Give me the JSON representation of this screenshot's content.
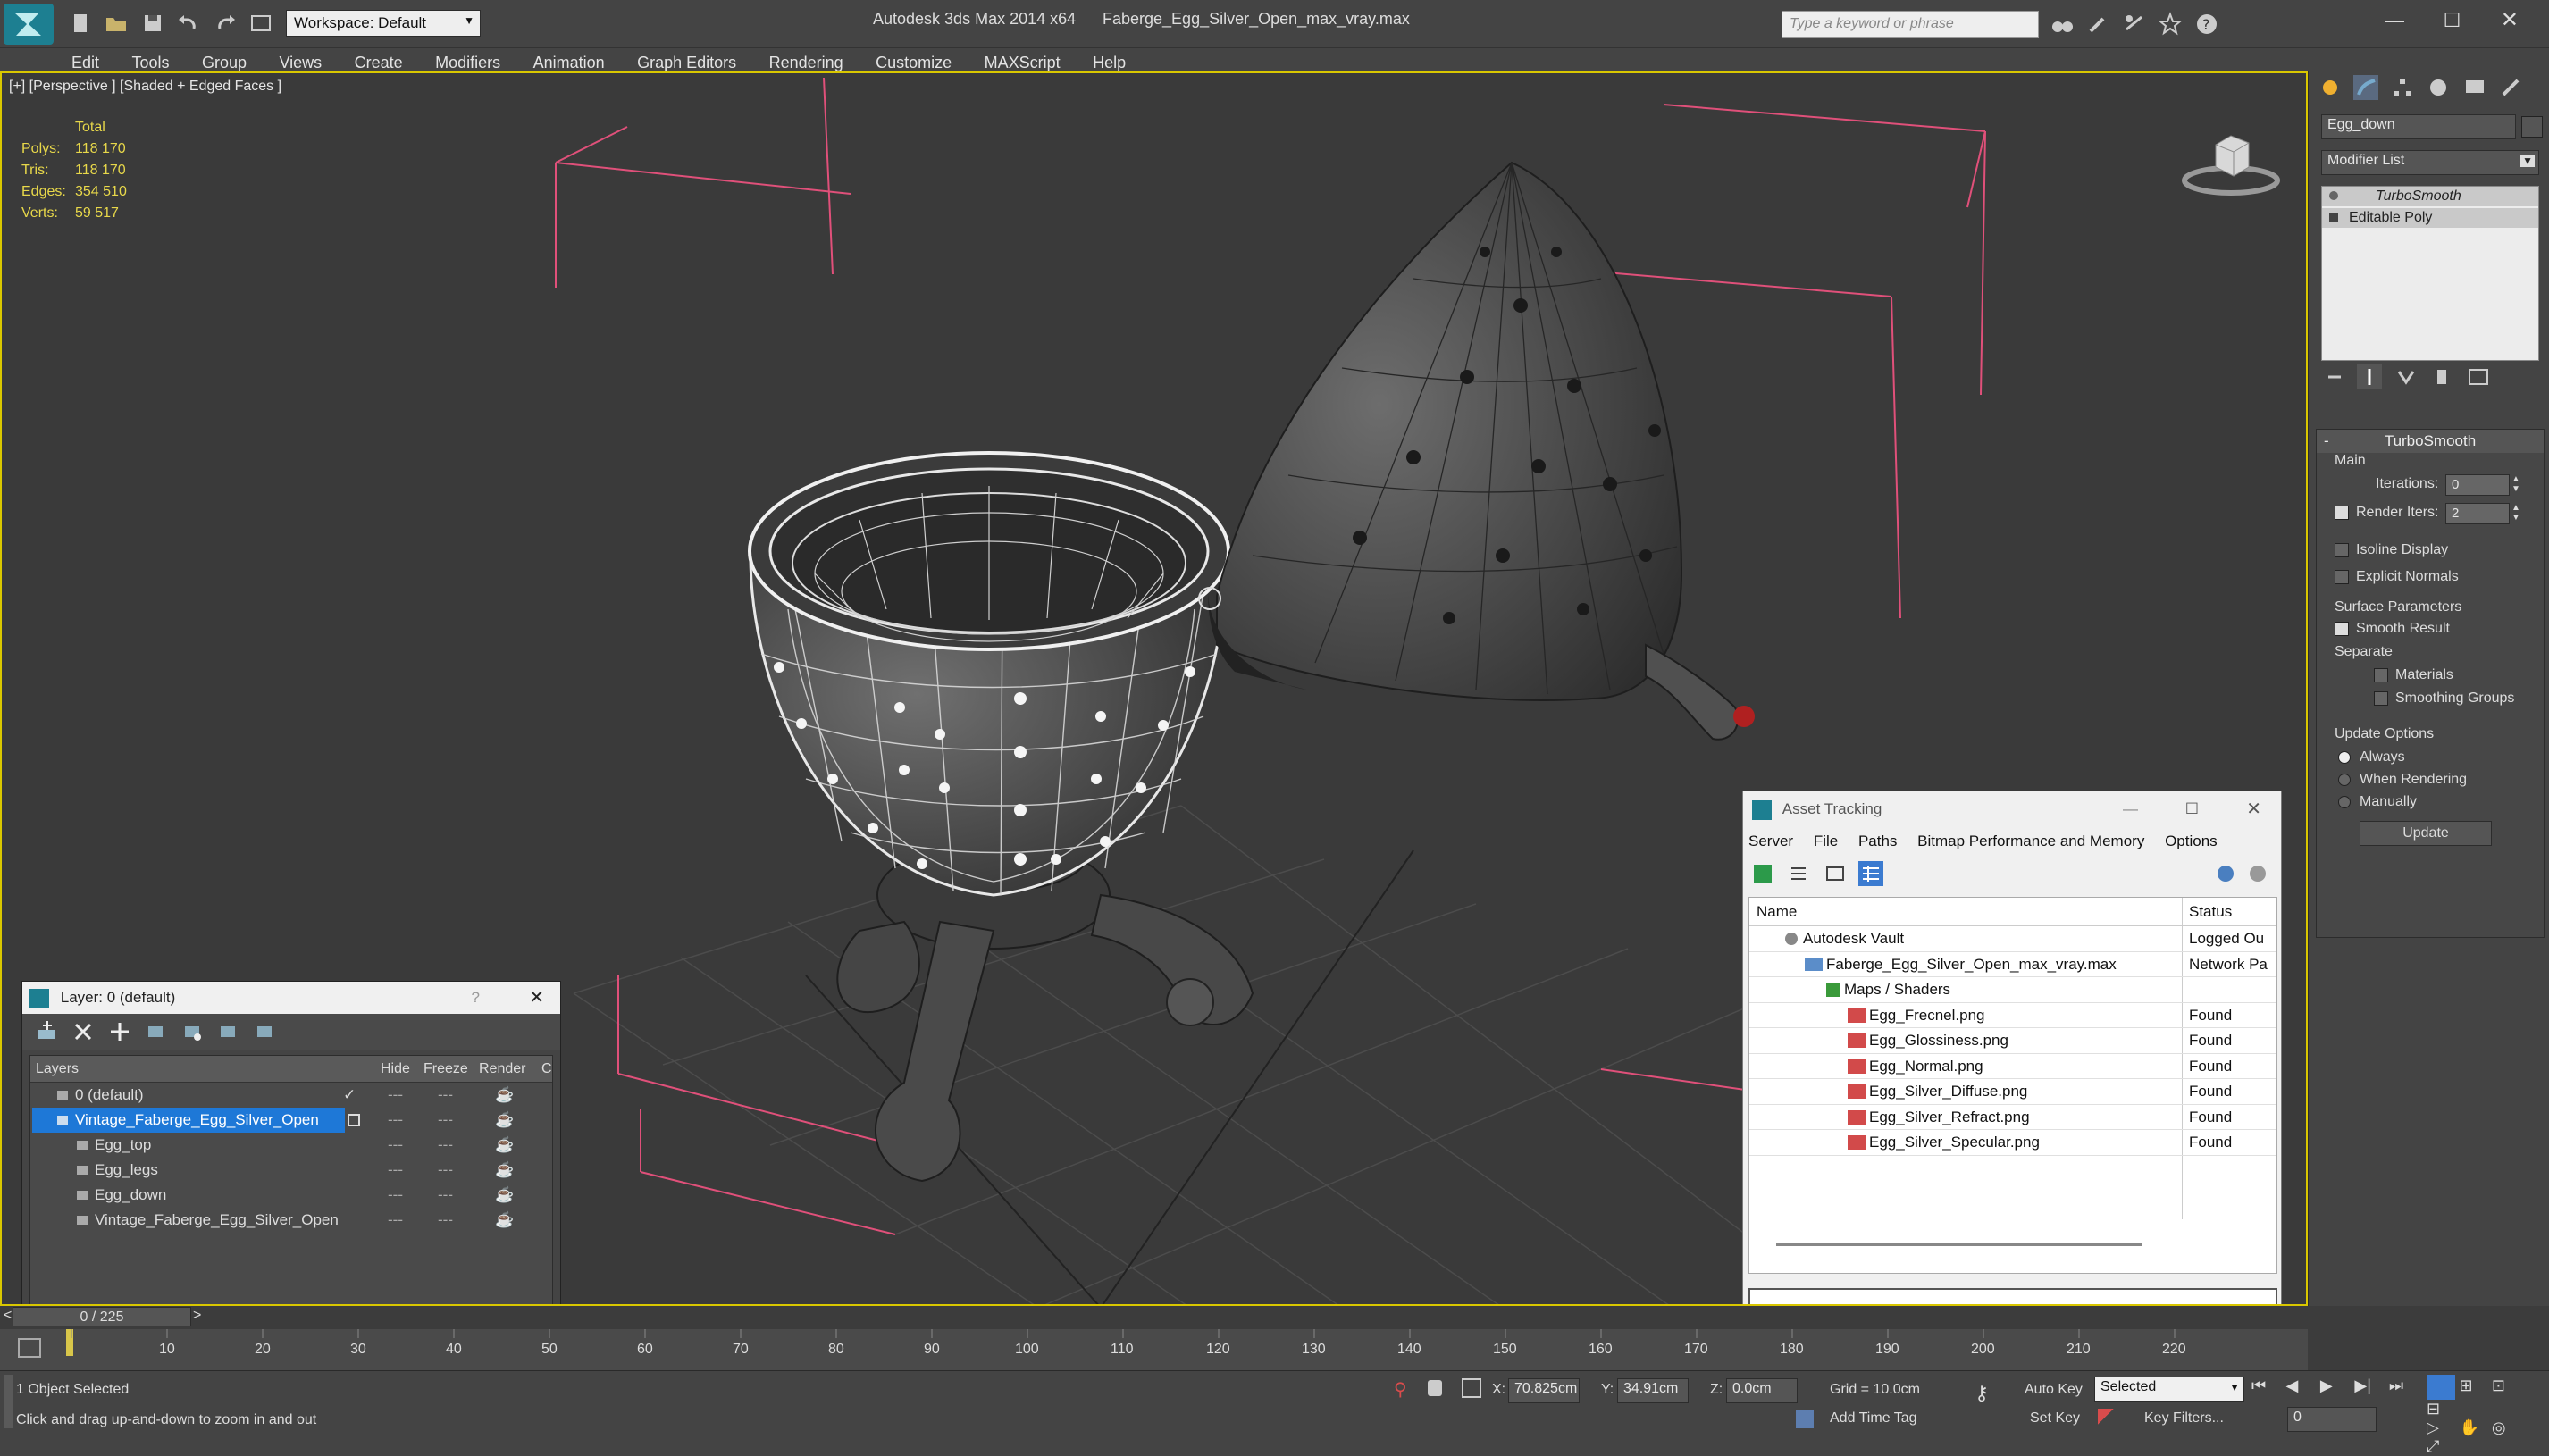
{
  "app": {
    "title": "Autodesk 3ds Max  2014 x64",
    "file_name": "Faberge_Egg_Silver_Open_max_vray.max",
    "workspace_label": "Workspace: Default",
    "search_placeholder": "Type a keyword or phrase"
  },
  "menu": [
    "Edit",
    "Tools",
    "Group",
    "Views",
    "Create",
    "Modifiers",
    "Animation",
    "Graph Editors",
    "Rendering",
    "Customize",
    "MAXScript",
    "Help"
  ],
  "viewport": {
    "label": "[+] [Perspective ] [Shaded + Edged Faces ]",
    "stats": {
      "header": "Total",
      "rows": [
        {
          "label": "Polys:",
          "value": "118 170"
        },
        {
          "label": "Tris:",
          "value": "118 170"
        },
        {
          "label": "Edges:",
          "value": "354 510"
        },
        {
          "label": "Verts:",
          "value": "59 517"
        }
      ]
    }
  },
  "command_panel": {
    "object_name": "Egg_down",
    "modifier_list": "Modifier List",
    "stack": [
      "TurboSmooth",
      "Editable Poly"
    ],
    "rollout_title": "TurboSmooth",
    "main_label": "Main",
    "iterations_label": "Iterations:",
    "iterations_value": "0",
    "render_iters_label": "Render Iters:",
    "render_iters_value": "2",
    "isoline": "Isoline Display",
    "explicit_normals": "Explicit Normals",
    "surface_params": "Surface Parameters",
    "smooth_result": "Smooth Result",
    "separate": "Separate",
    "materials": "Materials",
    "smoothing_groups": "Smoothing Groups",
    "update_options": "Update Options",
    "always": "Always",
    "when_rendering": "When Rendering",
    "manually": "Manually",
    "update_button": "Update"
  },
  "layers_window": {
    "title": "Layer: 0 (default)",
    "columns": [
      "Layers",
      "Hide",
      "Freeze",
      "Render",
      "C"
    ],
    "rows": [
      {
        "name": "0 (default)",
        "indent": 0,
        "selected": false
      },
      {
        "name": "Vintage_Faberge_Egg_Silver_Open",
        "indent": 0,
        "selected": true
      },
      {
        "name": "Egg_top",
        "indent": 1,
        "selected": false
      },
      {
        "name": "Egg_legs",
        "indent": 1,
        "selected": false
      },
      {
        "name": "Egg_down",
        "indent": 1,
        "selected": false
      },
      {
        "name": "Vintage_Faberge_Egg_Silver_Open",
        "indent": 1,
        "selected": false
      }
    ]
  },
  "asset_tracking": {
    "title": "Asset Tracking",
    "menu": [
      "Server",
      "File",
      "Paths",
      "Bitmap Performance and Memory",
      "Options"
    ],
    "columns": [
      "Name",
      "Status"
    ],
    "rows": [
      {
        "name": "Autodesk Vault",
        "status": "Logged Ou",
        "indent": 0
      },
      {
        "name": "Faberge_Egg_Silver_Open_max_vray.max",
        "status": "Network Pa",
        "indent": 1
      },
      {
        "name": "Maps / Shaders",
        "status": "",
        "indent": 2
      },
      {
        "name": "Egg_Frecnel.png",
        "status": "Found",
        "indent": 3
      },
      {
        "name": "Egg_Glossiness.png",
        "status": "Found",
        "indent": 3
      },
      {
        "name": "Egg_Normal.png",
        "status": "Found",
        "indent": 3
      },
      {
        "name": "Egg_Silver_Diffuse.png",
        "status": "Found",
        "indent": 3
      },
      {
        "name": "Egg_Silver_Refract.png",
        "status": "Found",
        "indent": 3
      },
      {
        "name": "Egg_Silver_Specular.png",
        "status": "Found",
        "indent": 3
      }
    ]
  },
  "timeline": {
    "frame_label": "0 / 225",
    "ticks": [
      "10",
      "20",
      "30",
      "40",
      "50",
      "60",
      "70",
      "80",
      "90",
      "100",
      "110",
      "120",
      "130",
      "140",
      "150",
      "160",
      "170",
      "180",
      "190",
      "200",
      "210",
      "220"
    ]
  },
  "status": {
    "selection": "1 Object Selected",
    "prompt": "Click and drag up-and-down to zoom in and out",
    "x_label": "X:",
    "x_value": "70.825cm",
    "y_label": "Y:",
    "y_value": "34.91cm",
    "z_label": "Z:",
    "z_value": "0.0cm",
    "grid": "Grid = 10.0cm",
    "auto_key": "Auto Key",
    "selected_dropdown": "Selected",
    "set_key": "Set Key",
    "key_filters": "Key Filters...",
    "add_time_tag": "Add Time Tag",
    "frame_value": "0"
  },
  "colors": {
    "viewport_border": "#d9c700",
    "stats_label": "#e8d84a",
    "selection_blue": "#1e78d7",
    "bbox_pink": "#e0507a"
  }
}
